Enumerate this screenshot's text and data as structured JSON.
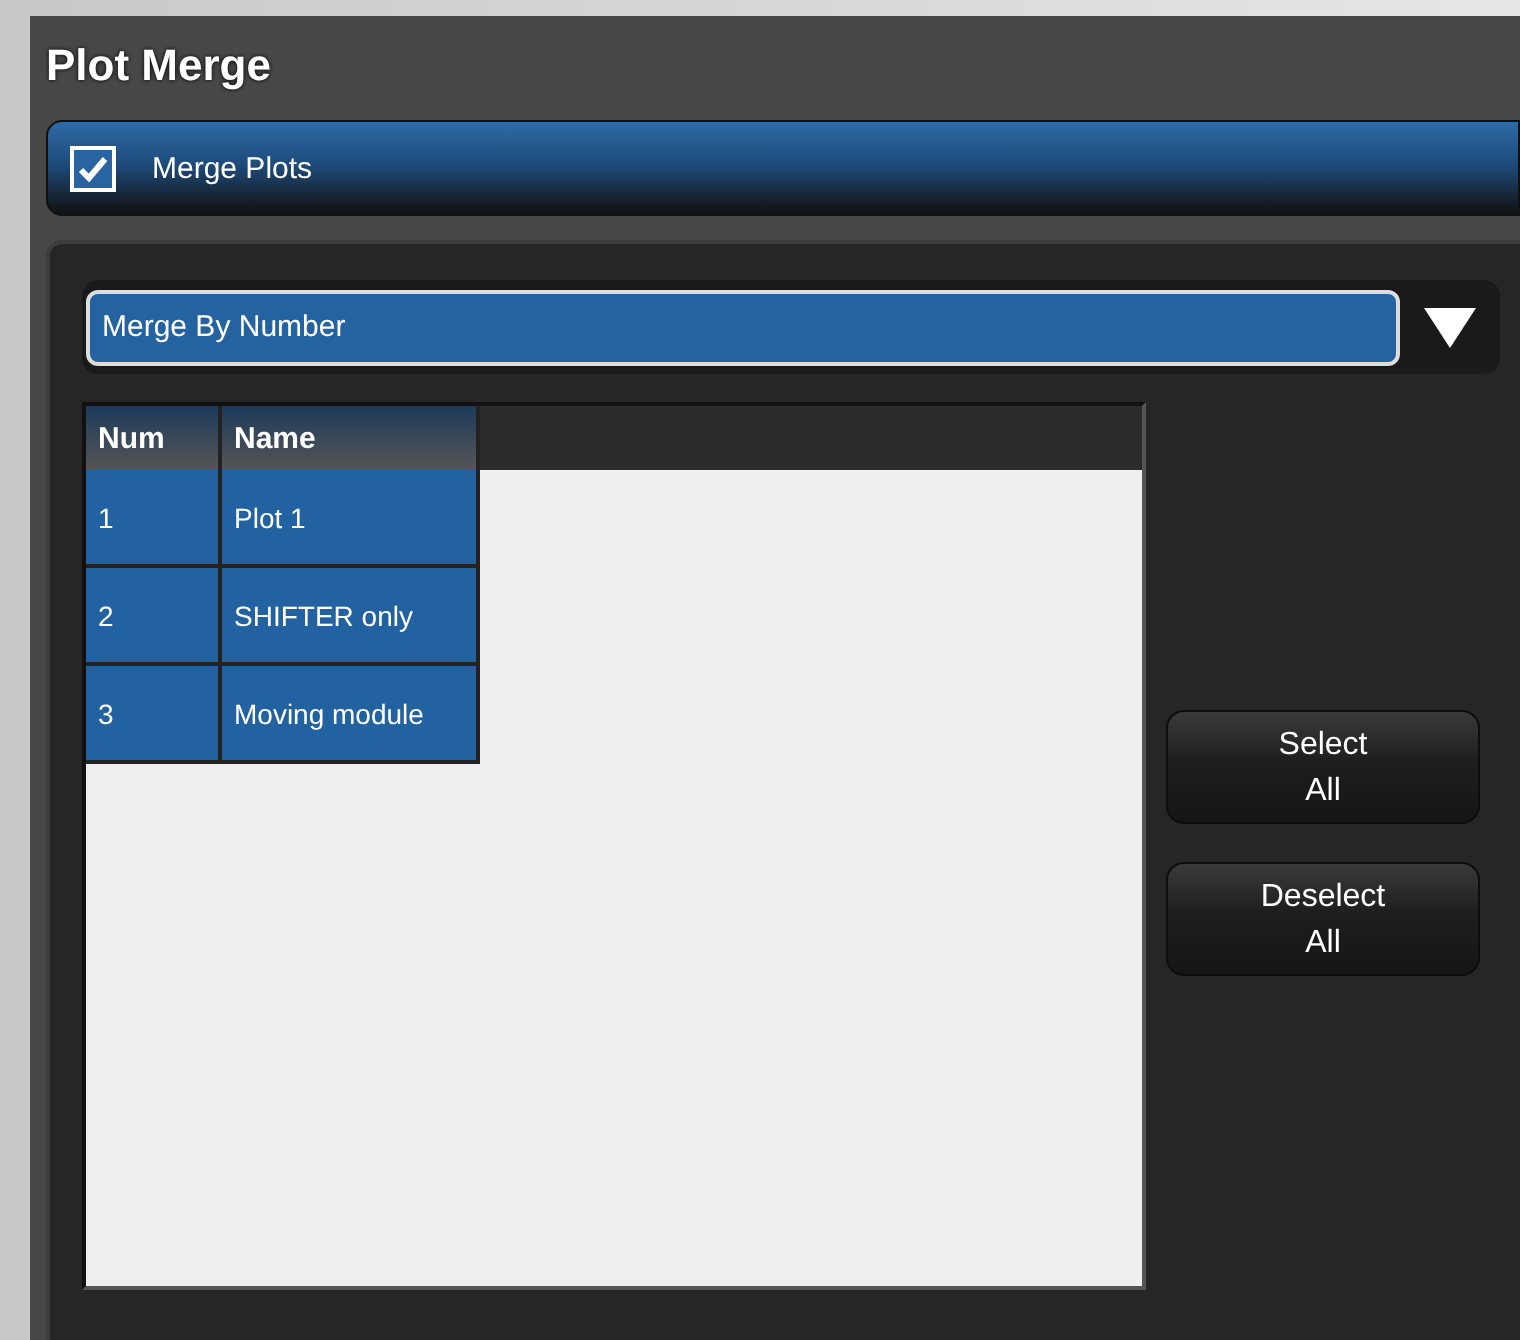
{
  "window": {
    "title": "Plot Merge"
  },
  "merge_plots": {
    "label": "Merge Plots",
    "checked": true
  },
  "merge_mode": {
    "value": "Merge By Number"
  },
  "table": {
    "columns": [
      "Num",
      "Name"
    ],
    "rows": [
      {
        "cells": [
          "1",
          "Plot 1"
        ],
        "selected": true
      },
      {
        "cells": [
          "2",
          "SHIFTER only"
        ],
        "selected": true
      },
      {
        "cells": [
          "3",
          "Moving module"
        ],
        "selected": true
      }
    ]
  },
  "buttons": [
    {
      "line1": "Select",
      "line2": "All"
    },
    {
      "line1": "Deselect",
      "line2": "All"
    }
  ]
}
